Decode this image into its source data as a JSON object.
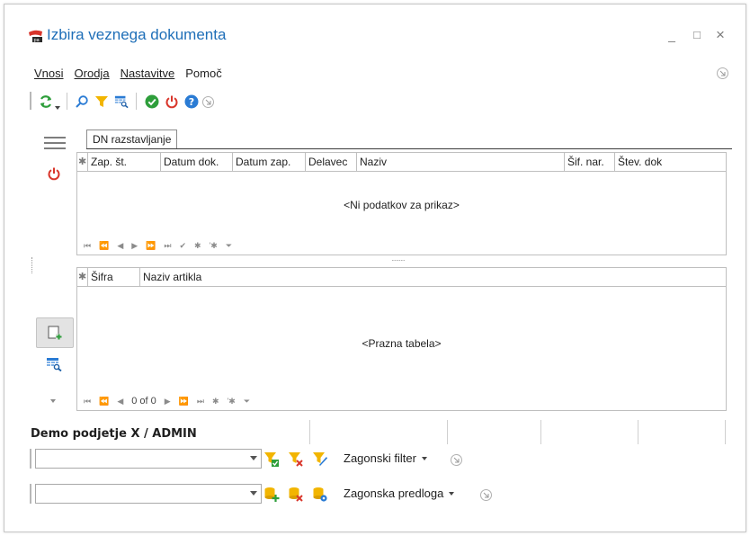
{
  "window": {
    "title": "Izbira veznega dokumenta",
    "minimize_glyph": "_",
    "maximize_glyph": "□",
    "close_glyph": "×"
  },
  "menu": {
    "items": [
      {
        "label": "Vnosi",
        "underline": true
      },
      {
        "label": "Orodja",
        "underline": true
      },
      {
        "label": "Nastavitve",
        "underline": true
      },
      {
        "label": "Pomoč",
        "underline": false
      }
    ]
  },
  "toolbar": {
    "icons": [
      "refresh-icon",
      "search-icon",
      "filter-icon",
      "table-search-icon",
      "confirm-icon",
      "power-icon",
      "help-icon",
      "more-icon"
    ]
  },
  "tab": {
    "label": "DN razstavljanje"
  },
  "top_grid": {
    "star": "✱",
    "columns": [
      "Zap. št.",
      "Datum dok.",
      "Datum zap.",
      "Delavec",
      "Naziv",
      "Šif. nar.",
      "Štev. dok"
    ],
    "empty_text": "<Ni podatkov za prikaz>",
    "navigator": [
      "⏮",
      "⏪",
      "◀",
      "▶",
      "⏩",
      "⏭",
      "✔",
      "✱",
      "'✱",
      "⏷"
    ]
  },
  "splitter": {
    "glyph": "·········"
  },
  "bottom_grid": {
    "star": "✱",
    "columns": [
      "Šifra",
      "Naziv artikla"
    ],
    "empty_text": "<Prazna tabela>",
    "record_text": "0 of 0",
    "navigator_left": [
      "⏮",
      "⏪",
      "◀"
    ],
    "navigator_right": [
      "▶",
      "⏩",
      "⏭",
      "✱",
      "'✱",
      "⏷"
    ]
  },
  "status": {
    "company": "Demo podjetje X / ADMIN"
  },
  "filters": {
    "filter_combo_value": "",
    "filter_label": "Zagonski filter",
    "template_combo_value": "",
    "template_label": "Zagonska predloga"
  },
  "colors": {
    "title": "#1f6fb8",
    "power_red": "#d9362b",
    "check_green": "#2e9e3b",
    "filter_yellow": "#f2b500",
    "help_blue": "#2a7bd4"
  }
}
